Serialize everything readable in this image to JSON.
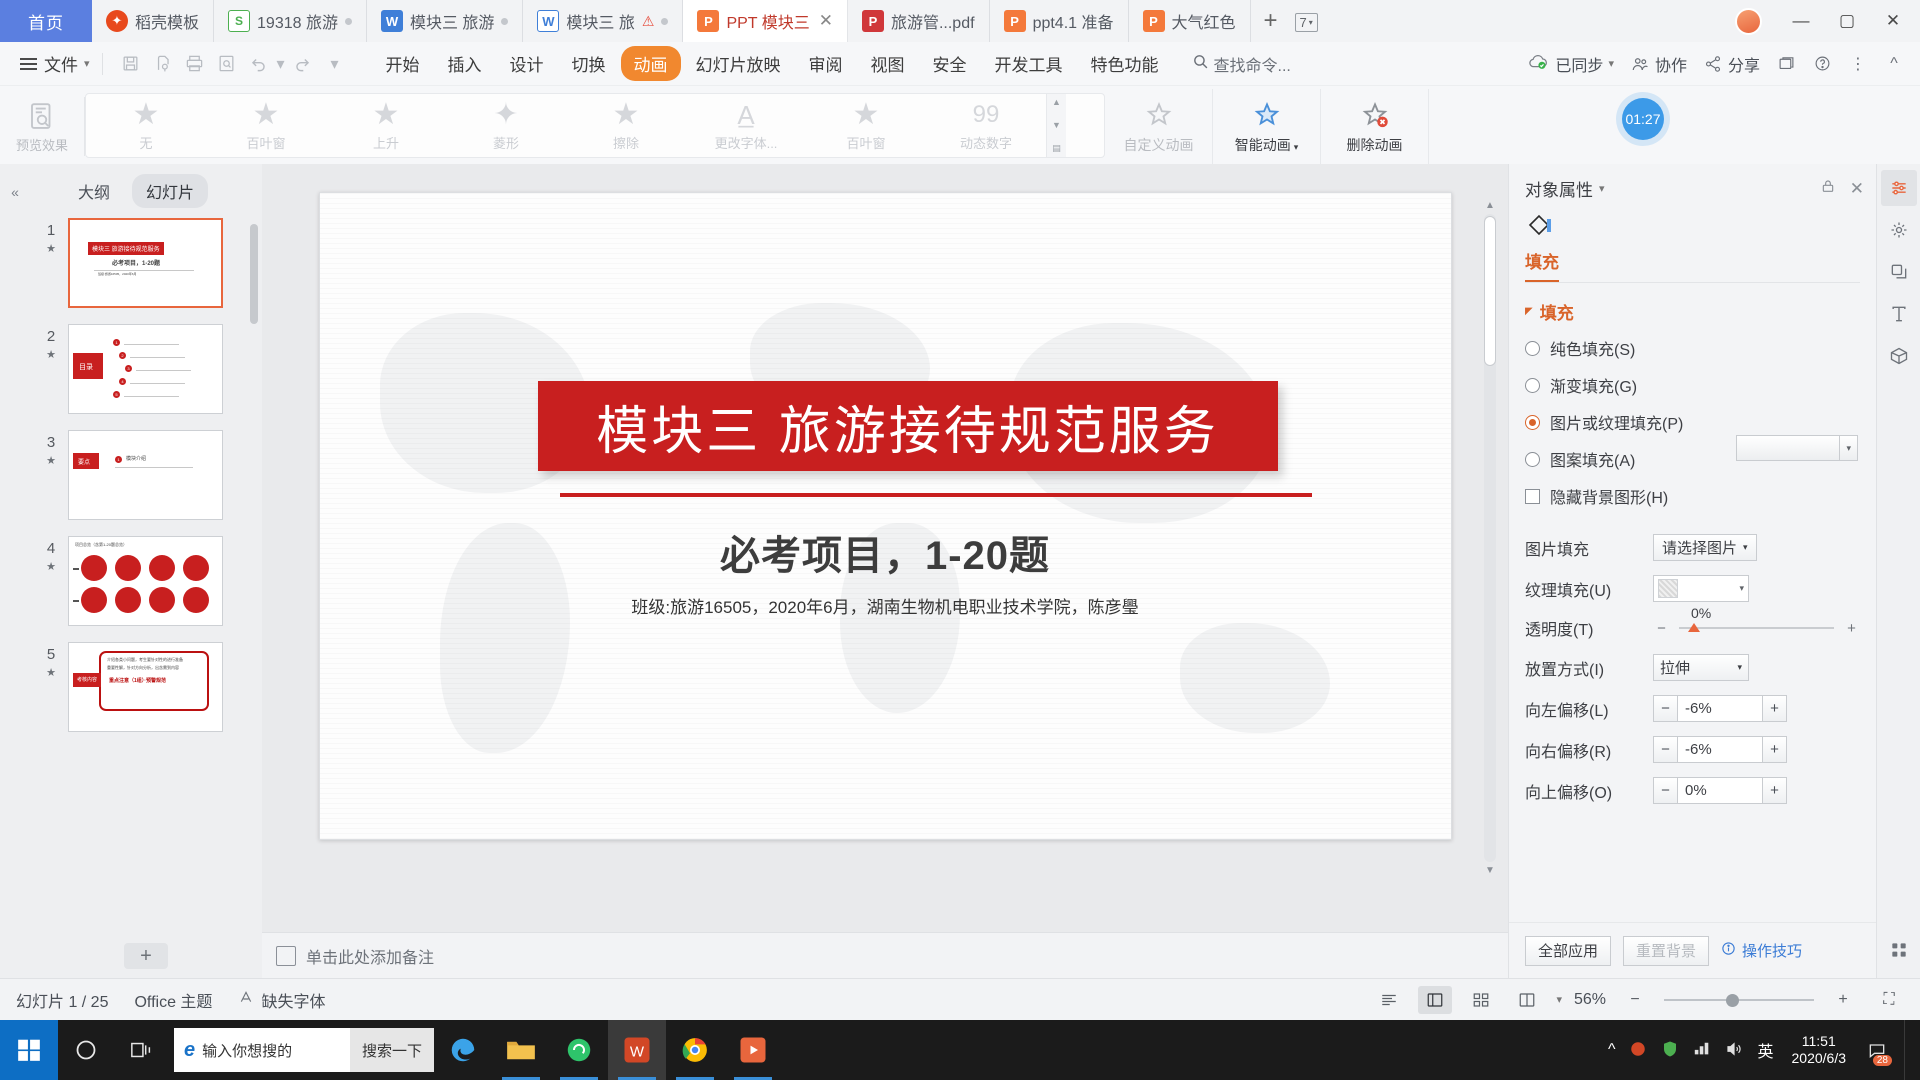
{
  "window": {
    "home_tab": "首页",
    "tab_count": "7",
    "minimize": "—",
    "maximize": "▢",
    "close": "✕",
    "collapse_ribbon": "^"
  },
  "tabs": [
    {
      "label": "稻壳模板",
      "icon": "dao-ke-icon",
      "icon_class": "ic-dao",
      "glyph": "📄",
      "modified": false,
      "warn": false,
      "active": false
    },
    {
      "label": "19318 旅游",
      "icon": "spreadsheet-icon",
      "icon_class": "ic-s",
      "glyph": "S",
      "modified": true,
      "warn": false,
      "active": false
    },
    {
      "label": "模块三  旅游",
      "icon": "writer-icon",
      "icon_class": "ic-w",
      "glyph": "W",
      "modified": true,
      "warn": false,
      "active": false
    },
    {
      "label": "模块三 旅",
      "icon": "writer-icon",
      "icon_class": "ic-wo",
      "glyph": "W",
      "modified": true,
      "warn": true,
      "active": false
    },
    {
      "label": "PPT 模块三",
      "icon": "presentation-icon",
      "icon_class": "ic-p",
      "glyph": "P",
      "modified": false,
      "warn": false,
      "active": true
    },
    {
      "label": "旅游管...pdf",
      "icon": "pdf-icon",
      "icon_class": "ic-pdf",
      "glyph": "P",
      "modified": false,
      "warn": false,
      "active": false
    },
    {
      "label": "ppt4.1 准备",
      "icon": "presentation-icon",
      "icon_class": "ic-p",
      "glyph": "P",
      "modified": false,
      "warn": false,
      "active": false
    },
    {
      "label": "大气红色",
      "icon": "presentation-icon",
      "icon_class": "ic-p",
      "glyph": "P",
      "modified": false,
      "warn": false,
      "active": false
    }
  ],
  "new_tab_label": "+",
  "menu": {
    "file_label": "文件",
    "quick_access": [
      "save-icon",
      "save-as-icon",
      "print-icon",
      "print-preview-icon",
      "undo-icon",
      "redo-icon",
      "customize-icon"
    ],
    "ribbon_tabs": [
      {
        "label": "开始",
        "active": false
      },
      {
        "label": "插入",
        "active": false
      },
      {
        "label": "设计",
        "active": false
      },
      {
        "label": "切换",
        "active": false
      },
      {
        "label": "动画",
        "active": true
      },
      {
        "label": "幻灯片放映",
        "active": false
      },
      {
        "label": "审阅",
        "active": false
      },
      {
        "label": "视图",
        "active": false
      },
      {
        "label": "安全",
        "active": false
      },
      {
        "label": "开发工具",
        "active": false
      },
      {
        "label": "特色功能",
        "active": false
      }
    ],
    "find_command": "查找命令...",
    "sync_label": "已同步",
    "collab_label": "协作",
    "share_label": "分享"
  },
  "ribbon": {
    "preview_label": "预览效果",
    "animations": [
      {
        "label": "无",
        "icon": "star-plain-icon"
      },
      {
        "label": "百叶窗",
        "icon": "star-blinds-icon"
      },
      {
        "label": "上升",
        "icon": "star-rise-icon"
      },
      {
        "label": "菱形",
        "icon": "star-diamond-icon"
      },
      {
        "label": "擦除",
        "icon": "star-wipe-icon"
      },
      {
        "label": "更改字体...",
        "icon": "letter-a-icon"
      },
      {
        "label": "百叶窗",
        "icon": "star-blinds2-icon"
      },
      {
        "label": "动态数字",
        "icon": "quote-99-icon"
      }
    ],
    "buttons": [
      {
        "label": "自定义动画",
        "icon": "custom-animation-icon",
        "dim": true
      },
      {
        "label": "智能动画",
        "icon": "smart-animation-icon",
        "dim": false,
        "dropdown": true
      },
      {
        "label": "删除动画",
        "icon": "delete-animation-icon",
        "dim": false
      }
    ],
    "timer": "01:27"
  },
  "thumbnails": {
    "tab_outline": "大纲",
    "tab_slides": "幻灯片",
    "collapse": "«",
    "add_slide": "+",
    "slides": [
      {
        "number": "1",
        "selected": true
      },
      {
        "number": "2",
        "selected": false
      },
      {
        "number": "3",
        "selected": false
      },
      {
        "number": "4",
        "selected": false
      },
      {
        "number": "5",
        "selected": false
      }
    ]
  },
  "slide": {
    "title": "模块三  旅游接待规范服务",
    "subtitle": "必考项目，1-20题",
    "meta": "班级:旅游16505，2020年6月，湖南生物机电职业技术学院，陈彦璺"
  },
  "notes": {
    "placeholder": "单击此处添加备注"
  },
  "properties": {
    "panel_title": "对象属性",
    "shape_icon": "shape-fill-icon",
    "tab_fill": "填充",
    "section_fill": "填充",
    "options": [
      {
        "label": "纯色填充(S)",
        "type": "radio",
        "checked": false
      },
      {
        "label": "渐变填充(G)",
        "type": "radio",
        "checked": false
      },
      {
        "label": "图片或纹理填充(P)",
        "type": "radio",
        "checked": true
      },
      {
        "label": "图案填充(A)",
        "type": "radio",
        "checked": false
      },
      {
        "label": "隐藏背景图形(H)",
        "type": "checkbox",
        "checked": false
      }
    ],
    "fields": {
      "picture_fill_label": "图片填充",
      "picture_fill_button": "请选择图片",
      "texture_fill_label": "纹理填充(U)",
      "transparency_label": "透明度(T)",
      "transparency_value": "0%",
      "placement_label": "放置方式(I)",
      "placement_value": "拉伸",
      "offset_left_label": "向左偏移(L)",
      "offset_left_value": "-6%",
      "offset_right_label": "向右偏移(R)",
      "offset_right_value": "-6%",
      "offset_top_label": "向上偏移(O)",
      "offset_top_value": "0%"
    },
    "footer": {
      "apply_all": "全部应用",
      "reset_bg": "重置背景",
      "tips": "操作技巧"
    },
    "minus": "−",
    "plus": "+"
  },
  "rail": [
    {
      "name": "properties-icon",
      "active": true
    },
    {
      "name": "magic-wand-icon",
      "active": false
    },
    {
      "name": "layers-icon",
      "active": false
    },
    {
      "name": "text-tool-icon",
      "active": false
    },
    {
      "name": "shapes-3d-icon",
      "active": false
    },
    {
      "name": "grid-apps-icon",
      "active": false
    }
  ],
  "statusbar": {
    "slide_counter": "幻灯片 1 / 25",
    "theme": "Office 主题",
    "missing_font": "缺失字体",
    "views": [
      "reading-view-icon",
      "normal-view-icon",
      "slide-sorter-icon",
      "notes-view-icon"
    ],
    "zoom_percent": "56%",
    "zoom_out": "−",
    "zoom_in": "+",
    "fullscreen": "⛶"
  },
  "taskbar": {
    "start": "start-icon",
    "search_placeholder": "输入你想搜的",
    "search_button": "搜索一下",
    "task_view": "task-view-icon",
    "apps": [
      {
        "name": "edge-icon",
        "running": false,
        "active": false
      },
      {
        "name": "file-explorer-icon",
        "running": true,
        "active": false
      },
      {
        "name": "browser-360-icon",
        "running": true,
        "active": false
      },
      {
        "name": "wps-writer-icon",
        "running": true,
        "active": true
      },
      {
        "name": "chrome-icon",
        "running": true,
        "active": false
      },
      {
        "name": "media-player-icon",
        "running": true,
        "active": false
      }
    ],
    "tray": {
      "show_hidden": "^",
      "language": "英",
      "time": "11:51",
      "date": "2020/6/3",
      "notification_count": "28"
    }
  },
  "colors": {
    "accent_orange": "#e8663d",
    "brand_red": "#c81f1f",
    "home_blue": "#5b7fe0",
    "panel_bg": "#f3f4f6",
    "taskbar": "#1b1b1b"
  }
}
